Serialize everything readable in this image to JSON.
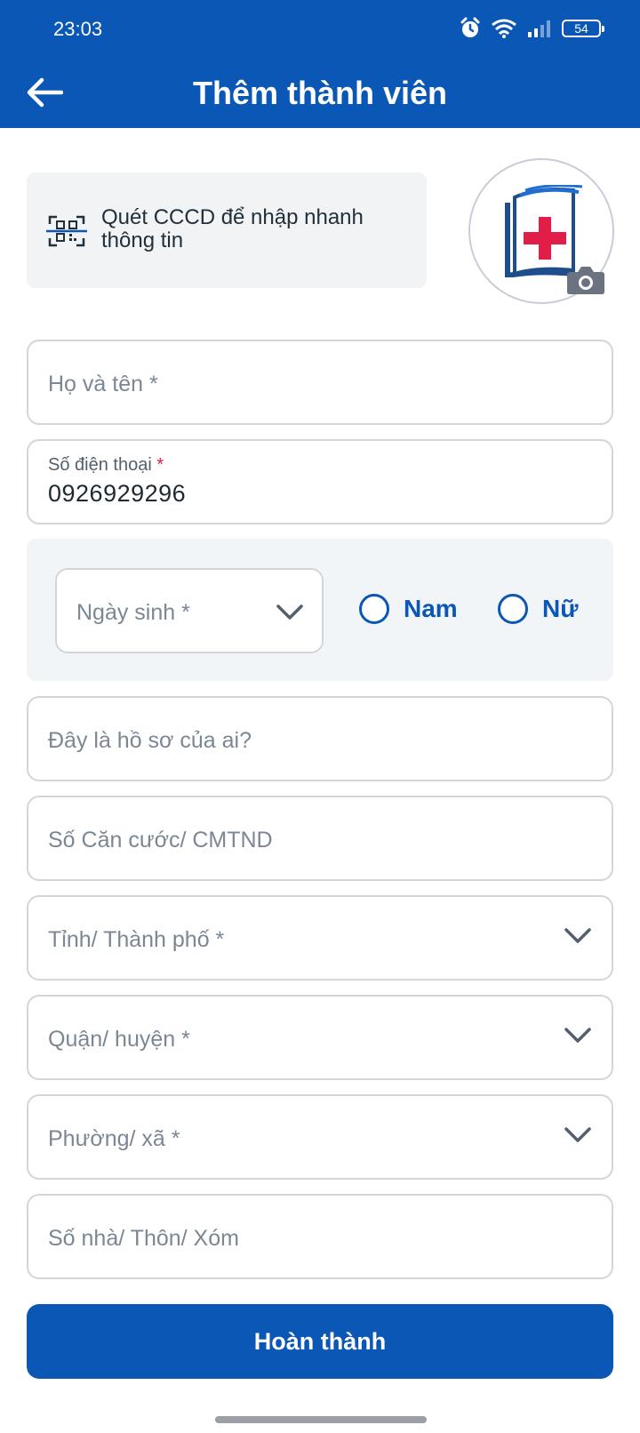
{
  "status_bar": {
    "time": "23:03",
    "battery": "54",
    "icons": [
      "alarm-icon",
      "wifi-icon",
      "signal-icon",
      "battery-icon"
    ]
  },
  "header": {
    "title": "Thêm thành viên",
    "back_icon": "arrow-left-icon"
  },
  "scan": {
    "label": "Quét CCCD để nhập nhanh thông tin",
    "icon": "qr-scan-icon"
  },
  "avatar": {
    "icon": "medical-book-logo",
    "camera_icon": "camera-icon"
  },
  "form": {
    "full_name": {
      "placeholder": "Họ và tên *"
    },
    "phone": {
      "label": "Số điện thoại",
      "required_mark": "*",
      "value": "0926929296"
    },
    "dob": {
      "placeholder": "Ngày sinh *"
    },
    "gender": {
      "male": "Nam",
      "female": "Nữ"
    },
    "relation": {
      "placeholder": "Đây là hồ sơ của ai?"
    },
    "id_number": {
      "placeholder": "Số Căn cước/ CMTND"
    },
    "province": {
      "placeholder": "Tỉnh/ Thành phố *"
    },
    "district": {
      "placeholder": "Quận/ huyện *"
    },
    "ward": {
      "placeholder": "Phường/ xã *"
    },
    "address": {
      "placeholder": "Số nhà/ Thôn/ Xóm"
    }
  },
  "submit": {
    "label": "Hoàn thành"
  },
  "colors": {
    "primary": "#0a57b5",
    "required": "#e11d48",
    "placeholder": "#7b8794",
    "border": "#d2d6db"
  }
}
